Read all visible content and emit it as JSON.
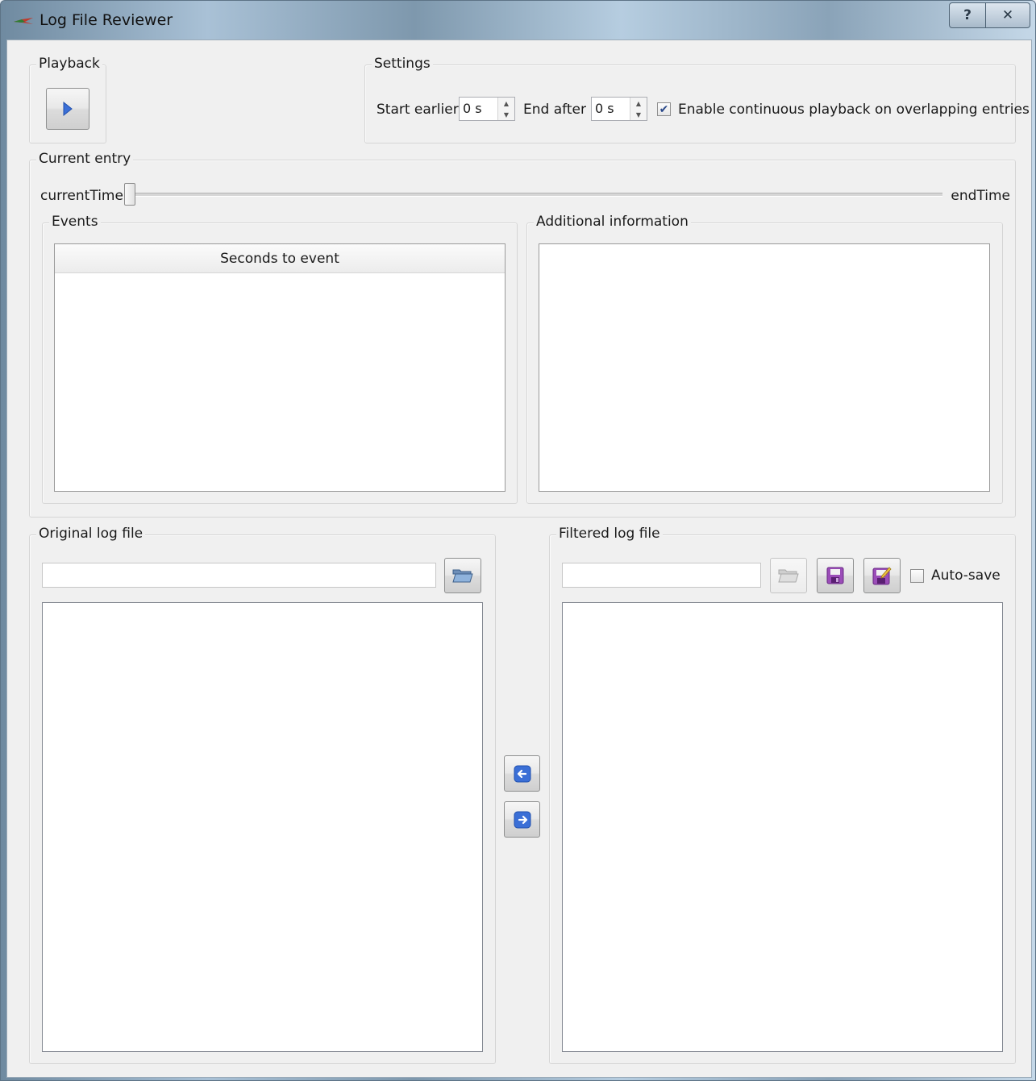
{
  "window": {
    "title": "Log File Reviewer",
    "help_glyph": "?",
    "close_glyph": "✕"
  },
  "playback": {
    "group_title": "Playback",
    "play_icon": "play-icon"
  },
  "settings": {
    "group_title": "Settings",
    "start_earlier_label": "Start earlier",
    "start_earlier_value": "0 s",
    "end_after_label": "End after",
    "end_after_value": "0 s",
    "continuous_checked": true,
    "continuous_label": "Enable continuous playback on overlapping entries"
  },
  "current_entry": {
    "group_title": "Current entry",
    "slider_left_label": "currentTime",
    "slider_right_label": "endTime",
    "slider_position": 0,
    "events": {
      "group_title": "Events",
      "column_header": "Seconds to event"
    },
    "additional": {
      "group_title": "Additional information"
    }
  },
  "original_log": {
    "group_title": "Original log file",
    "path": "",
    "open_icon": "folder-open-icon"
  },
  "filtered_log": {
    "group_title": "Filtered log file",
    "path": "",
    "open_icon": "folder-open-icon",
    "save_icon": "floppy-save-icon",
    "save_as_icon": "floppy-save-as-icon",
    "auto_save_checked": false,
    "auto_save_label": "Auto-save"
  },
  "transfer": {
    "left_icon": "arrow-left-icon",
    "right_icon": "arrow-right-icon"
  },
  "colors": {
    "accent_blue": "#3b6fd6",
    "purple": "#9b4db8",
    "check_mark": "#2c4a8a"
  }
}
